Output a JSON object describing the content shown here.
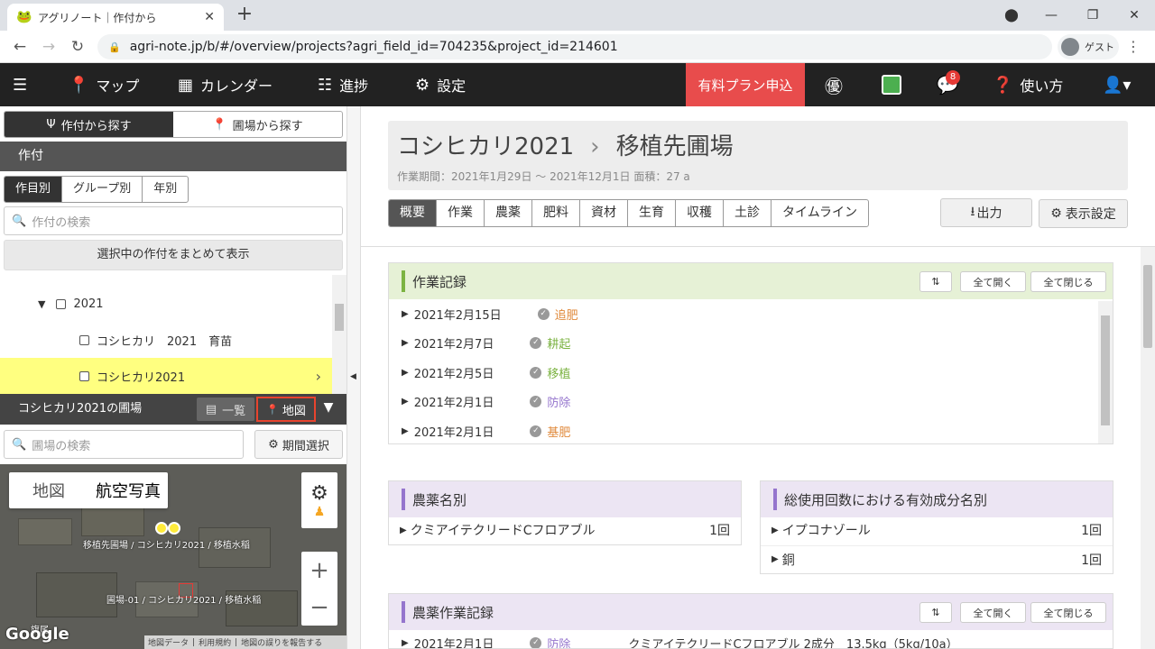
{
  "browser": {
    "tab_title": "アグリノート｜作付から",
    "url": "agri-note.jp/b/#/overview/projects?agri_field_id=704235&project_id=214601",
    "profile": "ゲスト"
  },
  "nav": {
    "map": "マップ",
    "calendar": "カレンダー",
    "progress": "進捗",
    "settings": "設定",
    "plan": "有料プラン申込",
    "help": "使い方",
    "notif_count": "8"
  },
  "left": {
    "tab_crop": "作付から探す",
    "tab_field": "圃場から探す",
    "section": "作付",
    "subtabs": [
      "作目別",
      "グループ別",
      "年別"
    ],
    "crop_search_placeholder": "作付の検索",
    "show_selected": "選択中の作付をまとめて表示",
    "tree": {
      "year": "2021",
      "items": [
        "コシヒカリ　2021　育苗",
        "コシヒカリ2021"
      ]
    },
    "field_title": "コシヒカリ2021の圃場",
    "list_btn": "一覧",
    "map_btn": "地図",
    "field_search_placeholder": "圃場の検索",
    "period_btn": "期間選択",
    "map": {
      "type_map": "地図",
      "type_aerial": "航空写真",
      "label1": "移植先圃場 / コシヒカリ2021 / 移植水稲",
      "label2": "圃場-01 / コシヒカリ2021 / 移植水稲",
      "footer": [
        "地図データ",
        "利用規約",
        "地図の誤りを報告する"
      ],
      "google": "Google",
      "partial": "旗尾"
    }
  },
  "main": {
    "crop": "コシヒカリ2021",
    "field": "移植先圃場",
    "period": "作業期間：2021年1月29日 ～ 2021年12月1日  面積：27 a",
    "tabs": [
      "概要",
      "作業",
      "農薬",
      "肥料",
      "資材",
      "生育",
      "収穫",
      "土診",
      "タイムライン"
    ],
    "export": "出力",
    "display_settings": "表示設定",
    "work": {
      "title": "作業記録",
      "open_all": "全て開く",
      "close_all": "全て閉じる",
      "rows": [
        {
          "date": "2021年2月15日",
          "task": "追肥",
          "color": "#e08a3c"
        },
        {
          "date": "2021年2月7日",
          "task": "耕起",
          "color": "#7cb342"
        },
        {
          "date": "2021年2月5日",
          "task": "移植",
          "color": "#7cb342"
        },
        {
          "date": "2021年2月1日",
          "task": "防除",
          "color": "#9575cd"
        },
        {
          "date": "2021年2月1日",
          "task": "基肥",
          "color": "#e08a3c"
        }
      ]
    },
    "pesticide_by_name": {
      "title": "農薬名別",
      "rows": [
        {
          "name": "クミアイテクリードCフロアブル",
          "count": "1回"
        }
      ]
    },
    "ingredient": {
      "title": "総使用回数における有効成分名別",
      "rows": [
        {
          "name": "イプコナゾール",
          "count": "1回"
        },
        {
          "name": "銅",
          "count": "1回"
        }
      ]
    },
    "pest_work": {
      "title": "農薬作業記録",
      "open_all": "全て開く",
      "close_all": "全て閉じる",
      "row": {
        "date": "2021年2月1日",
        "task": "防除",
        "detail": "クミアイテクリードCフロアブル 2成分　13.5kg（5kg/10a）"
      }
    }
  },
  "colors": {
    "plan": "#e84c4c",
    "nav_bg": "#222222",
    "accent_green": "#7cb342",
    "accent_purple": "#9575cd",
    "highlight": "#ffff80"
  }
}
